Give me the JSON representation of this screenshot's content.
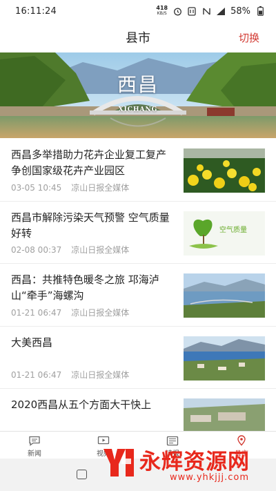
{
  "status_bar": {
    "time": "16:11:24",
    "net_speed": "418",
    "net_unit": "KB/S",
    "battery": "58%",
    "icons": [
      "alarm-icon",
      "nfc-icon",
      "mute-icon",
      "signal-4g-icon",
      "battery-icon"
    ]
  },
  "header": {
    "title": "县市",
    "switch_label": "切换"
  },
  "banner": {
    "title": "西昌",
    "subtitle": "XICHANG"
  },
  "news": [
    {
      "title": "西昌多举措助力花卉企业复工复产 争创国家级花卉产业园区",
      "date": "03-05  10:45",
      "source": "凉山日报全媒体",
      "thumb": "flowers"
    },
    {
      "title": "西昌市解除污染天气预警 空气质量好转",
      "date": "02-08  00:37",
      "source": "凉山日报全媒体",
      "thumb": "air-quality",
      "thumb_text": "空气质量"
    },
    {
      "title": "西昌：共推特色暖冬之旅 邛海泸山“牵手”海螺沟",
      "date": "01-21  06:47",
      "source": "凉山日报全媒体",
      "thumb": "lake"
    },
    {
      "title": "大美西昌",
      "date": "01-21  06:47",
      "source": "凉山日报全媒体",
      "thumb": "city-lake"
    },
    {
      "title": "2020西昌从五个方面大干快上",
      "date": "",
      "source": "",
      "thumb": "aerial"
    }
  ],
  "tabs": [
    {
      "label": "新闻",
      "icon": "chat-icon",
      "active": false
    },
    {
      "label": "视频",
      "icon": "video-icon",
      "active": false
    },
    {
      "label": "读报",
      "icon": "newspaper-icon",
      "active": false
    },
    {
      "label": "县市",
      "icon": "location-icon",
      "active": true
    }
  ],
  "watermark": {
    "text": "永辉资源网",
    "url": "www.yhkjjj.com"
  },
  "colors": {
    "accent": "#d23a32",
    "meta_text": "#a0a0a0"
  }
}
